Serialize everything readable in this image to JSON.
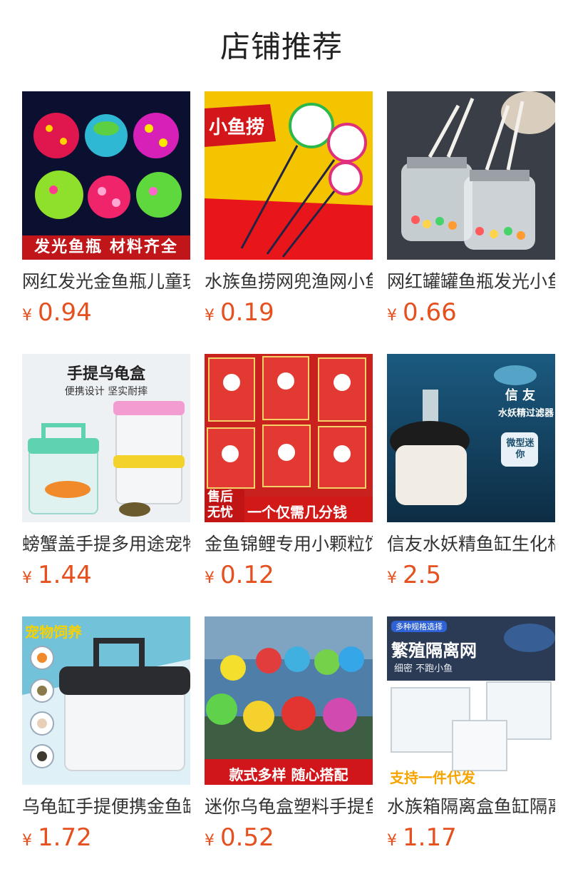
{
  "section": {
    "title": "店铺推荐"
  },
  "products": [
    {
      "name": "网红发光金鱼瓶儿童玩具",
      "currency": "¥",
      "price": "0.94",
      "banner": "发光鱼瓶 材料齐全",
      "colors": {
        "bg": "#0b1030",
        "banner": "#c0161a"
      }
    },
    {
      "name": "水族鱼捞网兜渔网小鱼捞",
      "currency": "¥",
      "price": "0.19",
      "banner": "小鱼捞",
      "colors": {
        "bg": "#f5c400",
        "banner": "#e8161b"
      }
    },
    {
      "name": "网红罐罐鱼瓶发光小鱼瓶",
      "currency": "¥",
      "price": "0.66",
      "colors": {
        "bg": "#3a3f47"
      }
    },
    {
      "name": "螃蟹盖手提多用途宠物盒",
      "currency": "¥",
      "price": "1.44",
      "heading": "手提乌龟盒",
      "subheading": "便携设计 坚实耐摔",
      "colors": {
        "bg": "#eef1f3"
      }
    },
    {
      "name": "金鱼锦鲤专用小颗粒饲料",
      "currency": "¥",
      "price": "0.12",
      "badge": "售后无忧",
      "banner": "一个仅需几分钱",
      "colors": {
        "bg": "#c9221e",
        "banner": "#d11a17"
      }
    },
    {
      "name": "信友水妖精鱼缸生化棉过滤器",
      "currency": "¥",
      "price": "2.5",
      "heading": "信 友",
      "subheading": "水妖精过滤器",
      "tag": "微型迷你",
      "colors": {
        "bg": "#1c4e6e"
      }
    },
    {
      "name": "乌龟缸手提便携金鱼缸",
      "currency": "¥",
      "price": "1.72",
      "heading": "宠物饲养",
      "side_labels": [
        "金鱼",
        "乌龟",
        "仓鼠",
        "蛇类"
      ],
      "colors": {
        "bg": "#dff1f6"
      }
    },
    {
      "name": "迷你乌龟盒塑料手提鱼瓶",
      "currency": "¥",
      "price": "0.52",
      "banner": "款式多样 随心搭配",
      "colors": {
        "bg": "#4f7fa8",
        "banner": "#d0161a"
      }
    },
    {
      "name": "水族箱隔离盒鱼缸隔离网",
      "currency": "¥",
      "price": "1.17",
      "badge": "多种规格选择",
      "heading": "繁殖隔离网",
      "subheading": "细密 不跑小鱼",
      "banner": "支持一件代发",
      "colors": {
        "bg": "#2b3b55"
      }
    }
  ]
}
